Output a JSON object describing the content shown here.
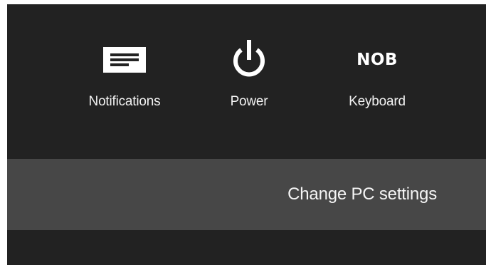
{
  "charms_panel": {
    "tiles": [
      {
        "label": "Notifications",
        "icon": "notifications-icon"
      },
      {
        "label": "Power",
        "icon": "power-icon"
      },
      {
        "label": "Keyboard",
        "icon": "keyboard-layout-indicator",
        "icon_text": "NOB"
      }
    ],
    "change_settings_label": "Change PC settings"
  },
  "colors": {
    "panel_background": "#222222",
    "settings_bar_background": "#474747",
    "text": "#ffffff"
  }
}
